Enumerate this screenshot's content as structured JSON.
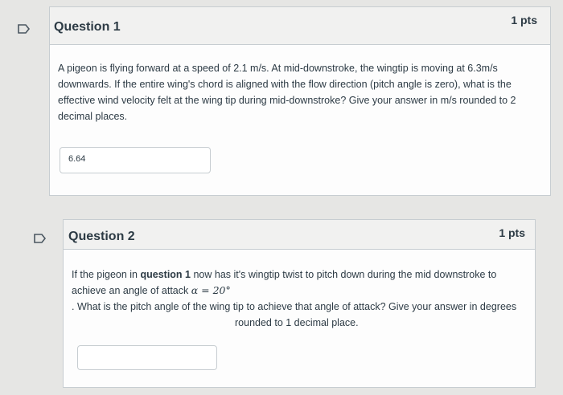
{
  "questions": [
    {
      "title": "Question 1",
      "points": "1 pts",
      "text": "A pigeon is flying forward at a speed of 2.1 m/s. At mid-downstroke, the wingtip is moving at 6.3m/s downwards. If the entire wing's chord is aligned with the flow direction (pitch angle is zero), what is the effective wind velocity felt at the wing tip during mid-downstroke? Give your answer in m/s rounded to 2 decimal places.",
      "answer": "6.64"
    },
    {
      "title": "Question 2",
      "points": "1 pts",
      "text_pre": "If the pigeon in ",
      "text_bold": "question 1",
      "text_post": " now has it's wingtip twist to pitch down during the mid downstroke to achieve an angle of attack ",
      "alpha_expr": "α = 20°",
      "text_line3": ". What is the pitch angle of the wing tip to achieve that angle of attack? Give your answer in degrees",
      "text_line4": "rounded to 1 decimal place.",
      "answer": ""
    }
  ],
  "icons": {
    "flag": "bookmark-flag-icon"
  }
}
